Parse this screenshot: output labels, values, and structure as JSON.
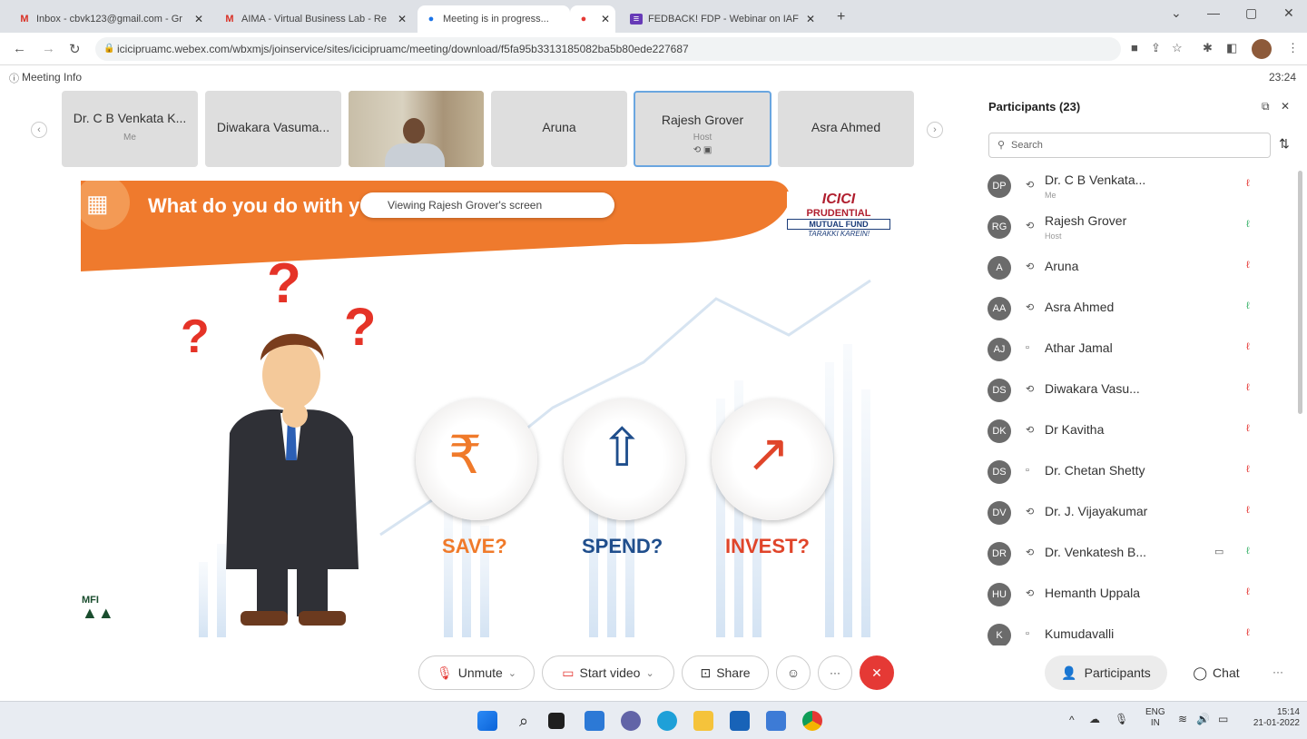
{
  "browser": {
    "tabs": [
      {
        "title": "Inbox - cbvk123@gmail.com - Gr",
        "favicon": "gmail-icon"
      },
      {
        "title": "AIMA - Virtual Business Lab - Re",
        "favicon": "gmail-icon"
      },
      {
        "title": "Meeting is in progress...",
        "favicon": "webex-icon"
      },
      {
        "title": "",
        "favicon": "record-icon"
      },
      {
        "title": "FEDBACK! FDP - Webinar on IAF",
        "favicon": "forms-icon"
      }
    ],
    "url": "icicipruamc.webex.com/wbxmjs/joinservice/sites/icicipruamc/meeting/download/f5fa95b3313185082ba5b80ede227687"
  },
  "meeting": {
    "info_label": "Meeting Info",
    "timer": "23:24"
  },
  "video_strip": {
    "tiles": [
      {
        "name": "Dr. C B Venkata K...",
        "sub": "Me"
      },
      {
        "name": "Diwakara Vasuma...",
        "sub": ""
      },
      {
        "name": "",
        "sub": ""
      },
      {
        "name": "Aruna",
        "sub": ""
      },
      {
        "name": "Rajesh Grover",
        "sub": "Host"
      },
      {
        "name": "Asra Ahmed",
        "sub": ""
      }
    ]
  },
  "slide": {
    "title": "What do you do with yo",
    "viewing_banner": "Viewing Rajesh Grover's screen",
    "logo_line1": "ICICI",
    "logo_line2": "PRUDENTIAL",
    "logo_line3": "MUTUAL FUND",
    "logo_tagline": "TARAKKI KAREIN!",
    "corner_logo": "MFI",
    "options": [
      {
        "label": "SAVE?",
        "color": "#f07a2a"
      },
      {
        "label": "SPEND?",
        "color": "#1f4e8c"
      },
      {
        "label": "INVEST?",
        "color": "#e0452a"
      }
    ]
  },
  "controls": {
    "unmute": "Unmute",
    "start_video": "Start video",
    "share": "Share"
  },
  "participants": {
    "title": "Participants (23)",
    "search_placeholder": "Search",
    "list": [
      {
        "initials": "DP",
        "name": "Dr. C B Venkata...",
        "sub": "Me",
        "muted": true
      },
      {
        "initials": "RG",
        "name": "Rajesh Grover",
        "sub": "Host",
        "muted": false
      },
      {
        "initials": "A",
        "name": "Aruna",
        "sub": "",
        "muted": true
      },
      {
        "initials": "AA",
        "name": "Asra Ahmed",
        "sub": "",
        "muted": false
      },
      {
        "initials": "AJ",
        "name": "Athar Jamal",
        "sub": "",
        "muted": true
      },
      {
        "initials": "DS",
        "name": "Diwakara Vasu...",
        "sub": "",
        "muted": true
      },
      {
        "initials": "DK",
        "name": "Dr Kavitha",
        "sub": "",
        "muted": true
      },
      {
        "initials": "DS",
        "name": "Dr. Chetan Shetty",
        "sub": "",
        "muted": true
      },
      {
        "initials": "DV",
        "name": "Dr. J. Vijayakumar",
        "sub": "",
        "muted": true
      },
      {
        "initials": "DR",
        "name": "Dr. Venkatesh B...",
        "sub": "",
        "muted": false
      },
      {
        "initials": "HU",
        "name": "Hemanth Uppala",
        "sub": "",
        "muted": true
      },
      {
        "initials": "K",
        "name": "Kumudavalli",
        "sub": "",
        "muted": true
      }
    ],
    "tab_participants": "Participants",
    "tab_chat": "Chat"
  },
  "taskbar": {
    "lang_line1": "ENG",
    "lang_line2": "IN",
    "time": "15:14",
    "date": "21-01-2022"
  }
}
